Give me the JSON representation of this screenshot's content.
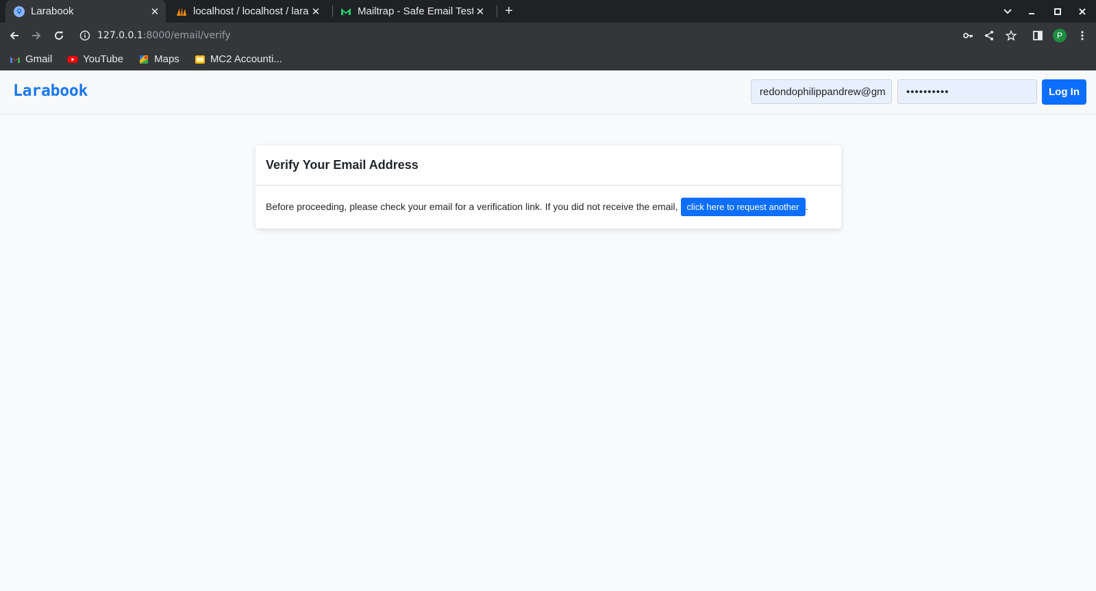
{
  "browser": {
    "tabs": [
      {
        "title": "Larabook",
        "active": true,
        "icon": "map-pin-icon"
      },
      {
        "title": "localhost / localhost / lara",
        "active": false,
        "icon": "phpmyadmin-icon"
      },
      {
        "title": "Mailtrap - Safe Email Testi",
        "active": false,
        "icon": "mailtrap-icon"
      }
    ],
    "new_tab_label": "+",
    "close_label": "✕",
    "url": {
      "host": "127.0.0.1",
      "path": ":8000/email/verify"
    },
    "profile_initial": "P",
    "bookmarks": [
      {
        "label": "Gmail",
        "icon": "gmail-icon"
      },
      {
        "label": "YouTube",
        "icon": "youtube-icon"
      },
      {
        "label": "Maps",
        "icon": "maps-icon"
      },
      {
        "label": "MC2 Accounti...",
        "icon": "folder-icon"
      }
    ]
  },
  "navbar": {
    "brand": "Larabook",
    "email_value": "redondophilippandrew@gm",
    "password_value": "••••••••••",
    "login_label": "Log In"
  },
  "card": {
    "title": "Verify Your Email Address",
    "body_text": "Before proceeding, please check your email for a verification link. If you did not receive the email,",
    "resend_label": "click here to request another",
    "trailing": "."
  },
  "colors": {
    "brand": "#1877f2",
    "primary": "#0d6efd",
    "chrome_dark": "#202124",
    "chrome_toolbar": "#35363a"
  }
}
